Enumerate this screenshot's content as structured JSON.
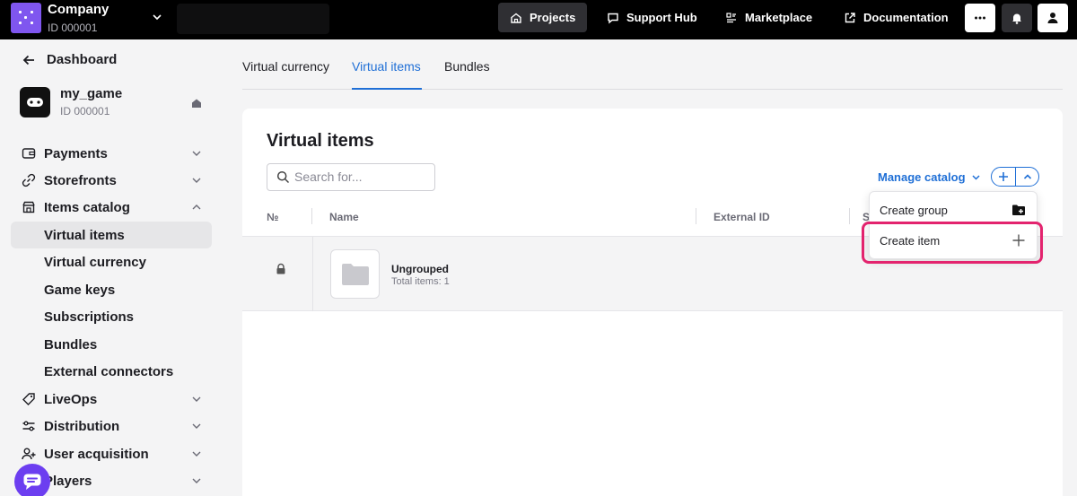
{
  "topbar": {
    "company_name": "Company",
    "company_id": "ID 000001",
    "nav": [
      {
        "label": "Projects",
        "icon": "home-icon"
      },
      {
        "label": "Support Hub",
        "icon": "chat-icon"
      },
      {
        "label": "Marketplace",
        "icon": "marketplace-icon"
      },
      {
        "label": "Documentation",
        "icon": "external-link-icon"
      }
    ],
    "buttons": [
      "more-icon",
      "bell-icon",
      "user-icon"
    ]
  },
  "sidebar": {
    "back_label": "Dashboard",
    "game_name": "my_game",
    "game_id": "ID 000001",
    "items": [
      {
        "label": "Payments",
        "icon": "wallet-icon"
      },
      {
        "label": "Storefronts",
        "icon": "link-icon"
      },
      {
        "label": "Items catalog",
        "icon": "store-icon"
      },
      {
        "label": "Virtual items"
      },
      {
        "label": "Virtual currency"
      },
      {
        "label": "Game keys"
      },
      {
        "label": "Subscriptions"
      },
      {
        "label": "Bundles"
      },
      {
        "label": "External connectors"
      },
      {
        "label": "LiveOps",
        "icon": "tag-icon"
      },
      {
        "label": "Distribution",
        "icon": "sliders-icon"
      },
      {
        "label": "User acquisition",
        "icon": "user-add-icon"
      },
      {
        "label": "Players",
        "icon": "players-icon"
      }
    ]
  },
  "tabs": [
    "Virtual currency",
    "Virtual items",
    "Bundles"
  ],
  "active_tab": "Virtual items",
  "main": {
    "title": "Virtual items",
    "search_placeholder": "Search for...",
    "manage_catalog": "Manage catalog",
    "columns": [
      "№",
      "Name",
      "External ID",
      "S"
    ],
    "rows": [
      {
        "name": "Ungrouped",
        "sub": "Total items: 1",
        "locked": true
      }
    ]
  },
  "dropdown": {
    "items": [
      {
        "label": "Create group",
        "icon": "folder-add-icon"
      },
      {
        "label": "Create item",
        "icon": "plus-icon"
      }
    ]
  },
  "colors": {
    "accent": "#1f6fd6",
    "brand": "#7f56ef",
    "highlight": "#e3236e"
  }
}
